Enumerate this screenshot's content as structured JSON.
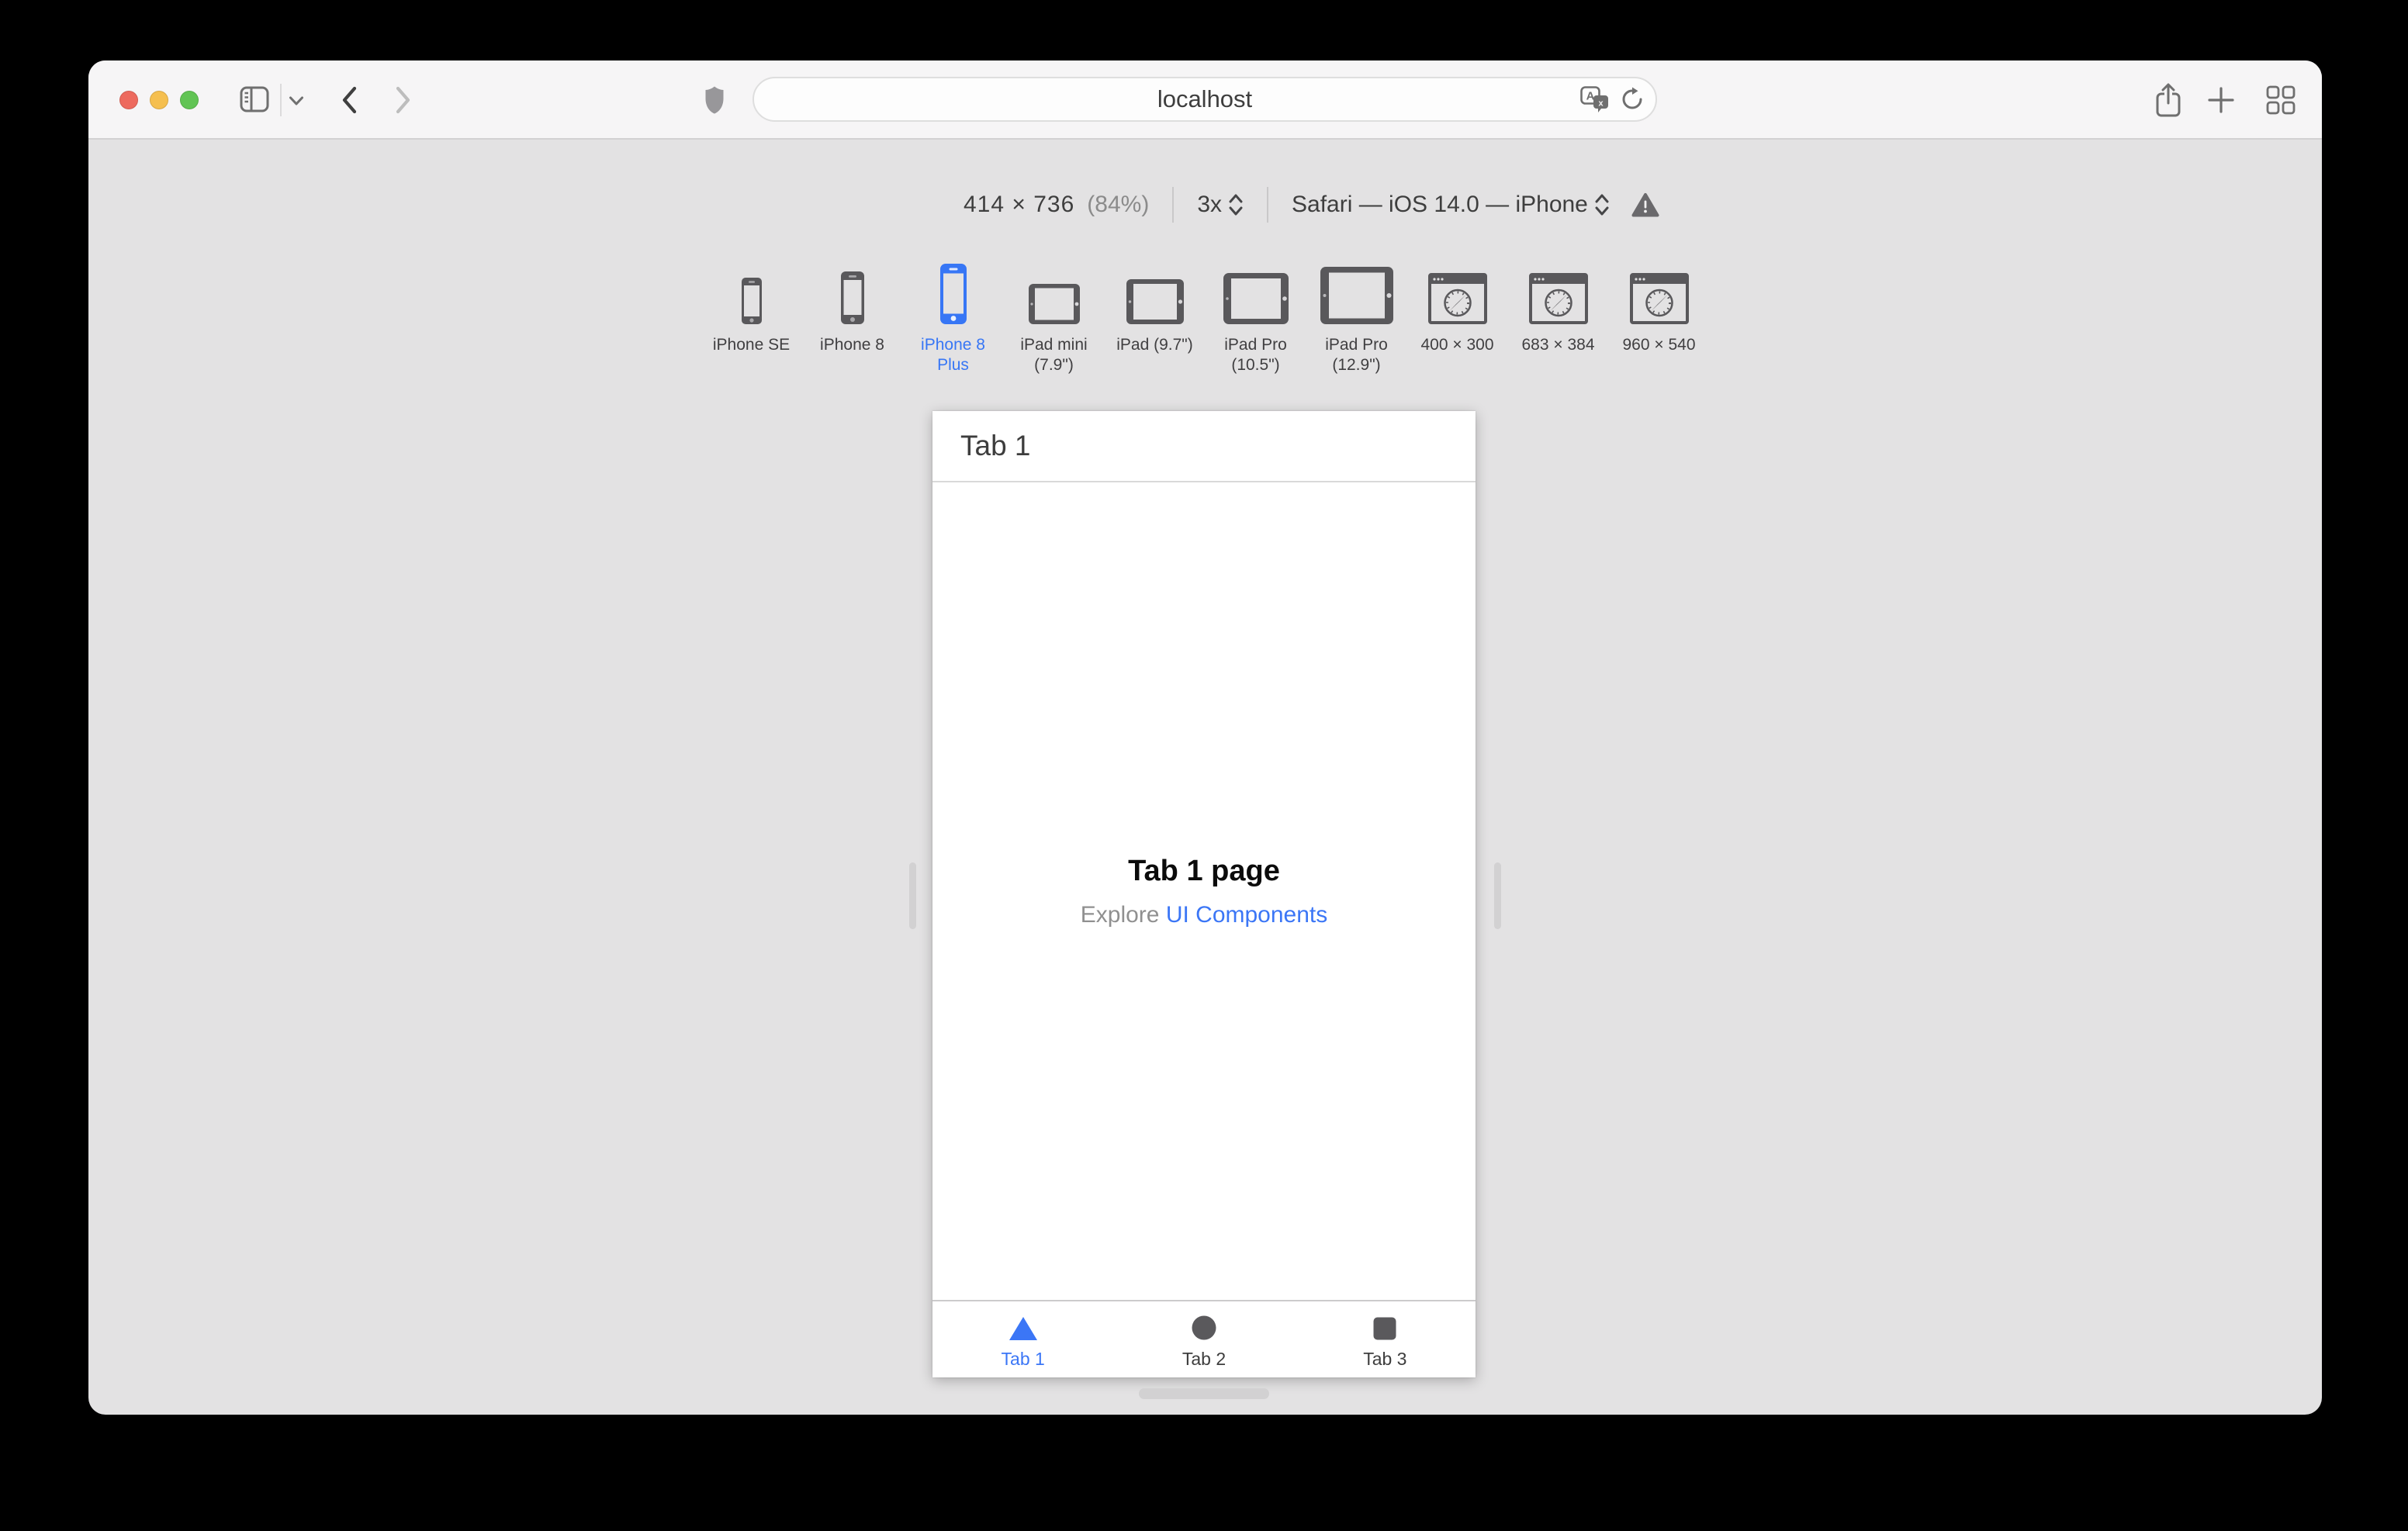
{
  "colors": {
    "accent_blue": "#3776f5",
    "traffic_red": "#ed6a5e",
    "traffic_yellow": "#f5bf4f",
    "traffic_green": "#61c454",
    "device_icon_gray": "#59585b",
    "toolbar_bg": "#f6f5f6",
    "content_bg": "#e3e2e3"
  },
  "toolbar": {
    "url": "localhost",
    "icons": [
      "sidebar-icon",
      "chevron-down-icon",
      "back-icon",
      "forward-icon",
      "shield-icon",
      "translate-icon",
      "reload-icon",
      "share-icon",
      "new-tab-icon",
      "tab-overview-icon"
    ]
  },
  "rdm": {
    "size": "414 × 736",
    "zoom_percent": "(84%)",
    "pixel_ratio": "3x",
    "user_agent": "Safari — iOS 14.0 — iPhone"
  },
  "devices": [
    {
      "label": "iPhone SE",
      "selected": false
    },
    {
      "label": "iPhone 8",
      "selected": false
    },
    {
      "label": "iPhone 8 Plus",
      "selected": true
    },
    {
      "label": "iPad mini (7.9\")",
      "selected": false
    },
    {
      "label": "iPad (9.7\")",
      "selected": false
    },
    {
      "label": "iPad Pro (10.5\")",
      "selected": false
    },
    {
      "label": "iPad Pro (12.9\")",
      "selected": false
    },
    {
      "label": "400 × 300",
      "selected": false
    },
    {
      "label": "683 × 384",
      "selected": false
    },
    {
      "label": "960 × 540",
      "selected": false
    }
  ],
  "preview": {
    "nav_title": "Tab 1",
    "heading": "Tab 1 page",
    "subtitle_text": "Explore ",
    "subtitle_link": "UI Components",
    "tabs": [
      {
        "label": "Tab 1",
        "icon": "triangle",
        "active": true
      },
      {
        "label": "Tab 2",
        "icon": "circle",
        "active": false
      },
      {
        "label": "Tab 3",
        "icon": "square",
        "active": false
      }
    ]
  }
}
